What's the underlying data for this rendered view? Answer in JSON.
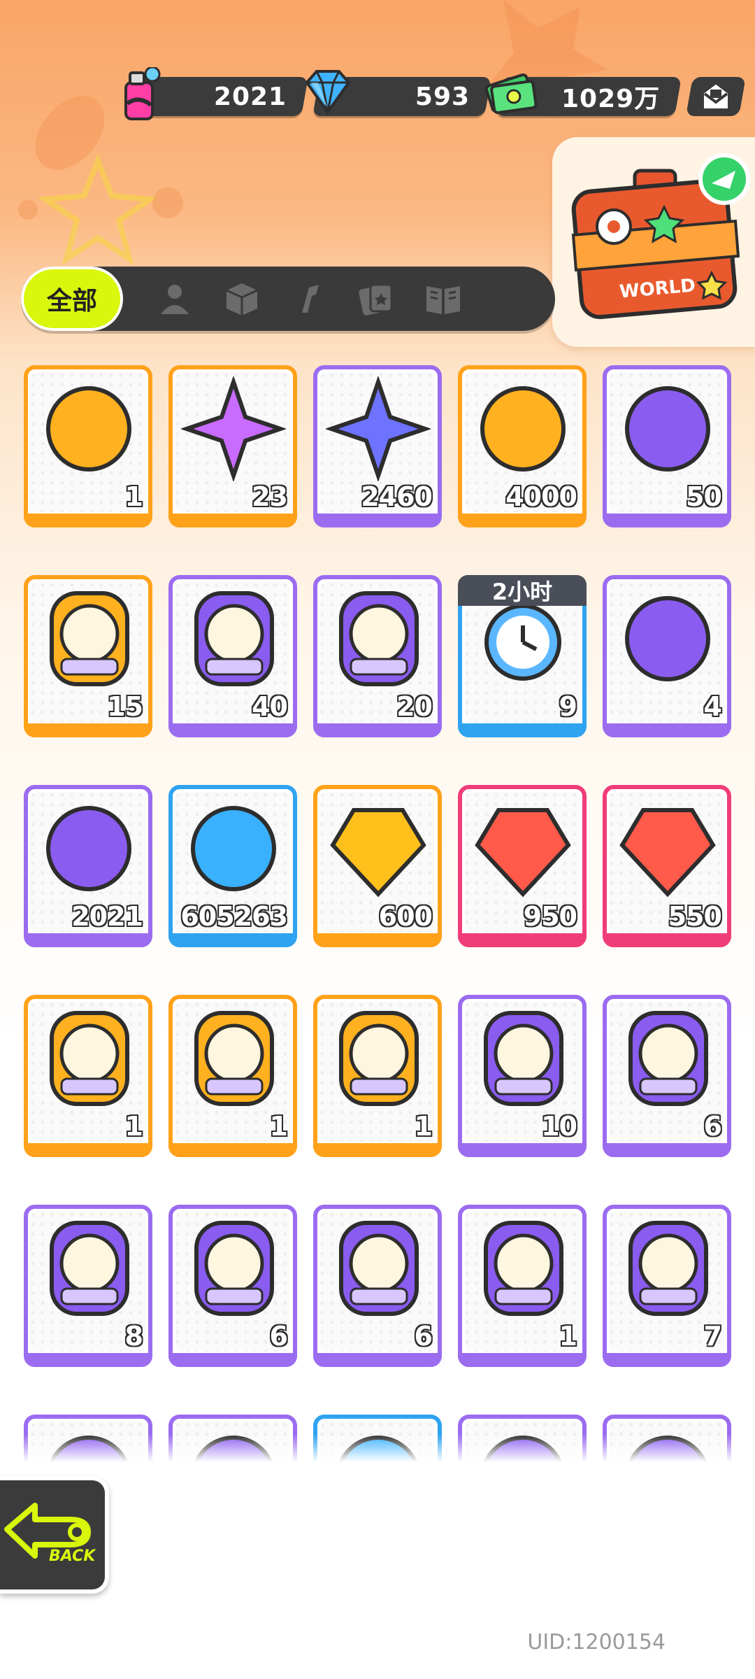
{
  "currencies": [
    {
      "icon": "spray-can-icon",
      "value": "2021"
    },
    {
      "icon": "diamond-icon",
      "value": "593"
    },
    {
      "icon": "cash-icon",
      "value": "1029万"
    }
  ],
  "mail_icon": "mail-icon",
  "suitcase": {
    "label": "WORLD"
  },
  "tabs": {
    "all_label": "全部",
    "icons": [
      "person-icon",
      "box-icon",
      "tool-icon",
      "cards-icon",
      "book-icon"
    ]
  },
  "items": [
    {
      "name": "ticket",
      "color": "orange",
      "count": "1"
    },
    {
      "name": "rainbow-star",
      "color": "orange",
      "count": "23"
    },
    {
      "name": "blue-star",
      "color": "purple",
      "count": "2460"
    },
    {
      "name": "cool-badge",
      "color": "orange",
      "count": "4000"
    },
    {
      "name": "mystery-egg",
      "color": "purple",
      "count": "50"
    },
    {
      "name": "gold-deity-card",
      "color": "orange",
      "count": "15"
    },
    {
      "name": "purple-deity-card",
      "color": "purple",
      "count": "40"
    },
    {
      "name": "travel-card",
      "color": "purple",
      "count": "20"
    },
    {
      "name": "alarm-clock",
      "color": "blue",
      "count": "9",
      "badge": "2小时"
    },
    {
      "name": "green-cup",
      "color": "purple",
      "count": "4"
    },
    {
      "name": "spray-can",
      "color": "purple",
      "count": "2021"
    },
    {
      "name": "paint-tube",
      "color": "blue",
      "count": "605263"
    },
    {
      "name": "gold-crystal",
      "color": "orange",
      "count": "600"
    },
    {
      "name": "red-crystal",
      "color": "pink",
      "count": "950"
    },
    {
      "name": "red-gem",
      "color": "pink",
      "count": "550"
    },
    {
      "name": "deity-blue-hair",
      "color": "orange",
      "count": "1"
    },
    {
      "name": "deity-orange-hair",
      "color": "orange",
      "count": "1"
    },
    {
      "name": "deity-blonde",
      "color": "orange",
      "count": "1"
    },
    {
      "name": "deity-silver",
      "color": "purple",
      "count": "10"
    },
    {
      "name": "deity-goggles",
      "color": "purple",
      "count": "6"
    },
    {
      "name": "deity-green-hat",
      "color": "purple",
      "count": "8"
    },
    {
      "name": "deity-dark-hair",
      "color": "purple",
      "count": "6"
    },
    {
      "name": "deity-glasses",
      "color": "purple",
      "count": "6"
    },
    {
      "name": "deity-white-hair",
      "color": "purple",
      "count": "1"
    },
    {
      "name": "deity-redhead",
      "color": "purple",
      "count": "7"
    },
    {
      "name": "partial-1",
      "color": "purple",
      "count": ""
    },
    {
      "name": "partial-2",
      "color": "purple",
      "count": ""
    },
    {
      "name": "partial-3",
      "color": "blue",
      "count": ""
    },
    {
      "name": "partial-4",
      "color": "purple",
      "count": ""
    },
    {
      "name": "partial-5",
      "color": "purple",
      "count": ""
    }
  ],
  "back": {
    "label": "BACK"
  },
  "uid": "UID:1200154",
  "colors": {
    "accent": "#d8f70c",
    "dark": "#3b3b3b",
    "orange": "#ffa21a",
    "purple": "#9b6cf0",
    "blue": "#2fa3f0",
    "pink": "#f03d7a"
  }
}
